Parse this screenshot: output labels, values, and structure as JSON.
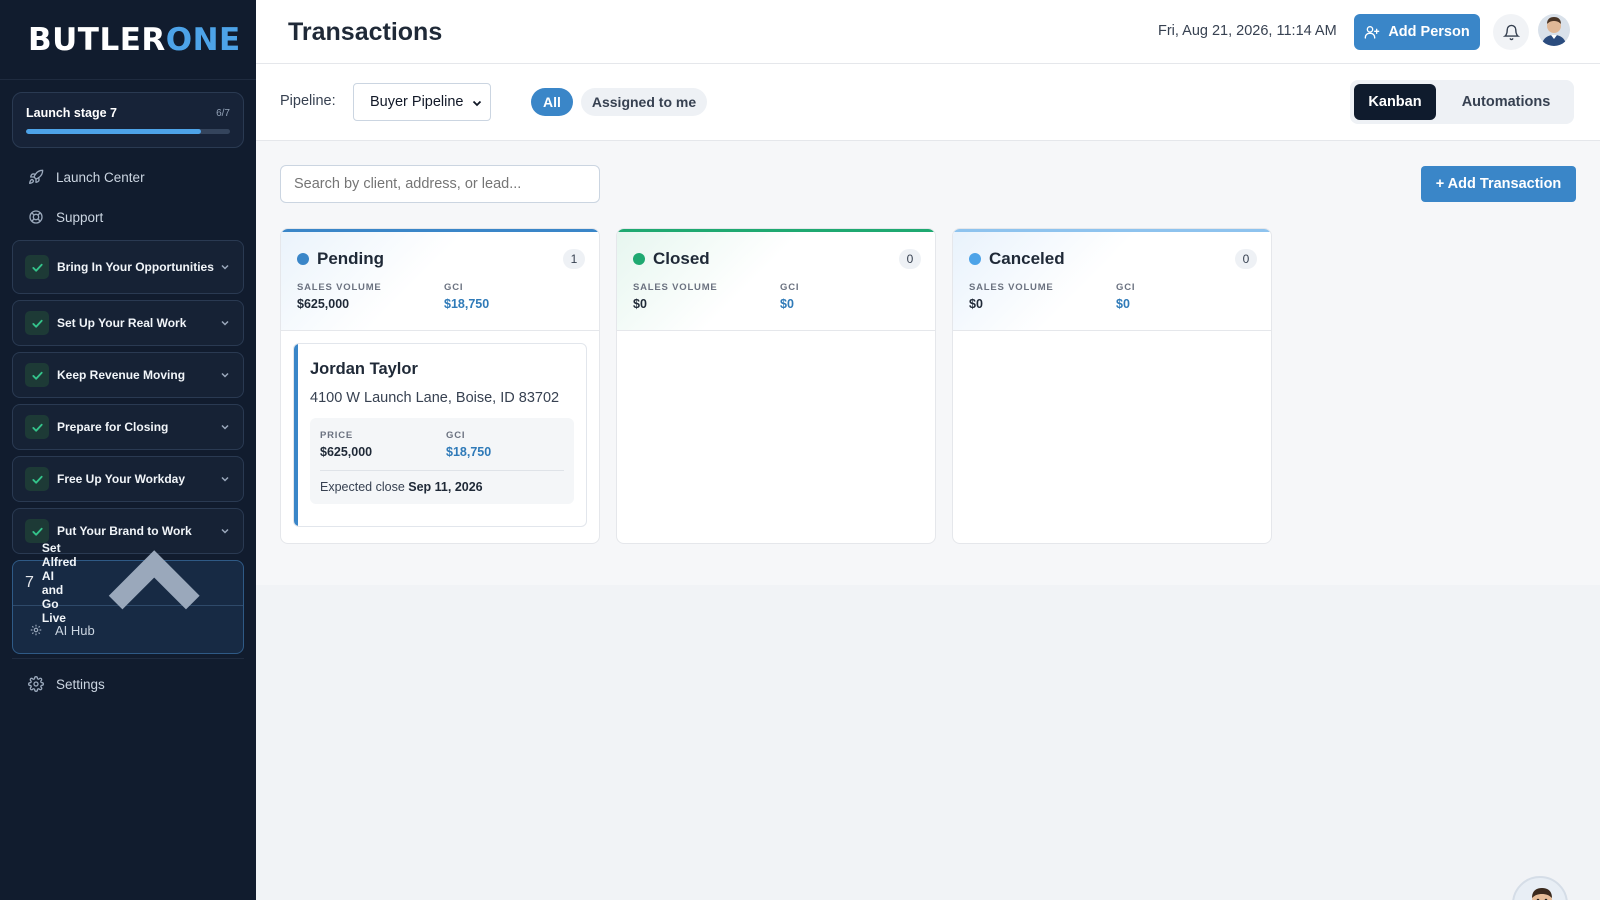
{
  "brand": {
    "prefix": "BUTLER",
    "suffix": "ONE"
  },
  "launch": {
    "title": "Launch stage 7",
    "count": "6/7",
    "progress": 0.86
  },
  "nav": {
    "launch_center": "Launch Center",
    "support": "Support",
    "settings": "Settings"
  },
  "stages": [
    {
      "label": "Bring In Your Opportunities",
      "done": true
    },
    {
      "label": "Set Up Your Real Work",
      "done": true
    },
    {
      "label": "Keep Revenue Moving",
      "done": true
    },
    {
      "label": "Prepare for Closing",
      "done": true
    },
    {
      "label": "Free Up Your Workday",
      "done": true
    },
    {
      "label": "Put Your Brand to Work",
      "done": true
    }
  ],
  "current_stage": {
    "number": "7",
    "label": "Set Alfred AI and Go Live",
    "item": "AI Hub"
  },
  "header": {
    "title": "Transactions",
    "datetime": "Fri, Aug 21, 2026, 11:14 AM",
    "add_person": "Add Person"
  },
  "toolbar": {
    "pipeline_label": "Pipeline:",
    "pipeline_value": "Buyer Pipeline",
    "filter_all": "All",
    "filter_assigned": "Assigned to me",
    "view_kanban": "Kanban",
    "view_automations": "Automations"
  },
  "search": {
    "placeholder": "Search by client, address, or lead..."
  },
  "add_transaction": "+ Add Transaction",
  "stat_labels": {
    "sales_volume": "SALES VOLUME",
    "gci": "GCI",
    "price": "PRICE"
  },
  "columns": [
    {
      "title": "Pending",
      "count": "1",
      "sales_volume": "$625,000",
      "gci": "$18,750",
      "color": "#3a86c8"
    },
    {
      "title": "Closed",
      "count": "0",
      "sales_volume": "$0",
      "gci": "$0",
      "color": "#1fa971"
    },
    {
      "title": "Canceled",
      "count": "0",
      "sales_volume": "$0",
      "gci": "$0",
      "color": "#4da3e8"
    }
  ],
  "transaction": {
    "client": "Jordan Taylor",
    "address": "4100 W Launch Lane, Boise, ID 83702",
    "price": "$625,000",
    "gci": "$18,750",
    "expected_close_label": "Expected close",
    "expected_close": "Sep 11, 2026"
  },
  "colors": {
    "accent": "#3a86c8",
    "sidebar_bg": "#111c2e",
    "success": "#1fa971"
  }
}
